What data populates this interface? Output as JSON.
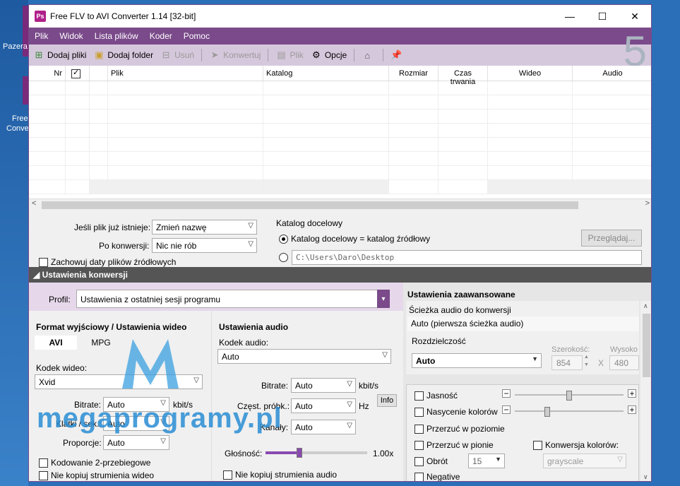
{
  "desktop": {
    "icon1": "Pazera",
    "icon2_line1": "Free",
    "icon2_line2": "Conver"
  },
  "window": {
    "title": "Free FLV to AVI Converter 1.14  [32-bit]",
    "minimize": "—",
    "maximize": "☐",
    "close": "✕"
  },
  "menu": [
    "Plik",
    "Widok",
    "Lista plików",
    "Koder",
    "Pomoc"
  ],
  "toolbar": {
    "add_files": "Dodaj pliki",
    "add_folder": "Dodaj folder",
    "remove": "Usuń",
    "convert": "Konwertuj",
    "file": "Plik",
    "options": "Opcje",
    "badge": "5"
  },
  "grid": {
    "columns": [
      "Nr",
      "",
      "Plik",
      "Katalog",
      "Rozmiar",
      "Czas trwania",
      "Wideo",
      "Audio"
    ]
  },
  "options": {
    "exists_label": "Jeśli plik już istnieje:",
    "exists_value": "Zmień nazwę",
    "after_label": "Po konwersji:",
    "after_value": "Nic nie rób",
    "keep_dates": "Zachowuj daty plików źródłowych",
    "dest_title": "Katalog docelowy",
    "dest_same": "Katalog docelowy = katalog źródłowy",
    "dest_path": "C:\\Users\\Daro\\Desktop",
    "browse": "Przeglądaj..."
  },
  "section": {
    "title": "Ustawienia konwersji"
  },
  "profile": {
    "label": "Profil:",
    "value": "Ustawienia z ostatniej sesji programu"
  },
  "video": {
    "title": "Format wyjściowy / Ustawienia wideo",
    "tab_avi": "AVI",
    "tab_mpg": "MPG",
    "codec_label": "Kodek wideo:",
    "codec_value": "Xvid",
    "bitrate_label": "Bitrate:",
    "bitrate_value": "Auto",
    "bitrate_unit": "kbit/s",
    "fps_label": "Klatki / sek.:",
    "fps_value": "Auto",
    "aspect_label": "Proporcje:",
    "aspect_value": "Auto",
    "two_pass": "Kodowanie 2-przebiegowe",
    "no_copy_video": "Nie kopiuj strumienia wideo"
  },
  "audio": {
    "title": "Ustawienia audio",
    "codec_label": "Kodek audio:",
    "codec_value": "Auto",
    "bitrate_label": "Bitrate:",
    "bitrate_value": "Auto",
    "bitrate_unit": "kbit/s",
    "info": "Info",
    "rate_label": "Częst. próbk.:",
    "rate_value": "Auto",
    "rate_unit": "Hz",
    "channels_label": "Kanały:",
    "channels_value": "Auto",
    "volume_label": "Głośność:",
    "volume_value": "1.00x",
    "volume_level": 0.33,
    "no_copy_audio": "Nie kopiuj strumienia audio"
  },
  "advanced": {
    "title": "Ustawienia zaawansowane",
    "track_label": "Ścieżka audio do konwersji",
    "track_value": "Auto (pierwsza ścieżka audio)",
    "resolution_label": "Rozdzielczość",
    "resolution_value": "Auto",
    "width_label": "Szerokość:",
    "width_value": "854",
    "height_label": "Wysoko",
    "height_value": "480",
    "x": "X",
    "brightness": "Jasność",
    "saturation": "Nasycenie kolorów",
    "brightness_level": 0.5,
    "saturation_level": 0.3,
    "flip_h": "Przerzuć w poziomie",
    "flip_v": "Przerzuć w pionie",
    "rotate": "Obrót",
    "rotate_value": "15",
    "color_conv": "Konwersja kolorów:",
    "color_conv_value": "grayscale",
    "negative": "Negative"
  },
  "watermark": {
    "text": "megaprogramy.pl"
  }
}
